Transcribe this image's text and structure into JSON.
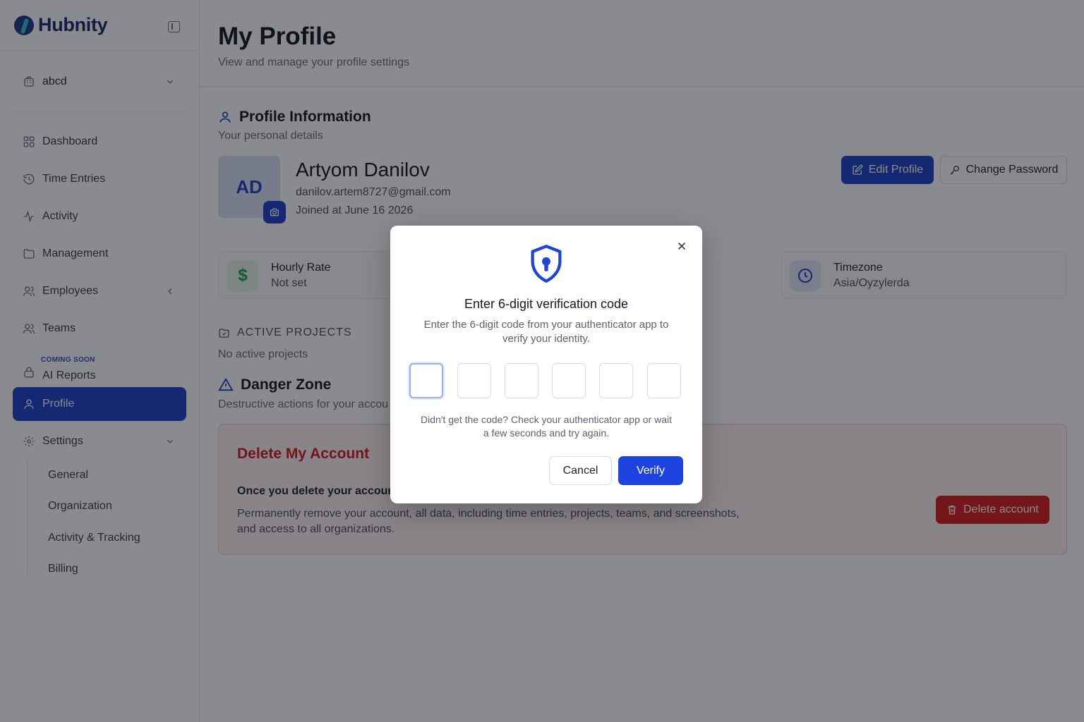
{
  "brand": {
    "name": "Hubnity"
  },
  "org": {
    "name": "abcd"
  },
  "nav": {
    "dashboard": "Dashboard",
    "time_entries": "Time Entries",
    "activity": "Activity",
    "management": "Management",
    "employees": "Employees",
    "teams": "Teams",
    "ai_reports": "AI Reports",
    "ai_reports_badge": "COMING SOON",
    "profile": "Profile",
    "settings": "Settings",
    "settings_sub": [
      "General",
      "Organization",
      "Activity & Tracking",
      "Billing"
    ]
  },
  "header": {
    "title": "My Profile",
    "subtitle": "View and manage your profile settings"
  },
  "profile_info": {
    "title": "Profile Information",
    "subtitle": "Your personal details",
    "initials": "AD",
    "name": "Artyom Danilov",
    "email": "danilov.artem8727@gmail.com",
    "joined": "Joined at June 16 2026",
    "edit_label": "Edit Profile",
    "change_password_label": "Change Password"
  },
  "stats": {
    "hourly_rate_label": "Hourly Rate",
    "hourly_rate_value": "Not set",
    "timezone_label": "Timezone",
    "timezone_value": "Asia/Oyzylerda"
  },
  "projects": {
    "title": "ACTIVE PROJECTS",
    "empty": "No active projects"
  },
  "danger": {
    "title": "Danger Zone",
    "subtitle": "Destructive actions for your accou",
    "box_title": "Delete My Account",
    "box_strong": "Once you delete your account",
    "box_text": "Permanently remove your account, all data, including time entries, projects, teams, and screenshots, and access to all organizations.",
    "delete_label": "Delete account"
  },
  "modal": {
    "title": "Enter 6-digit verification code",
    "description": "Enter the 6-digit code from your authenticator app to verify your identity.",
    "hint": "Didn't get the code? Check your authenticator app or wait a few seconds and try again.",
    "cancel_label": "Cancel",
    "verify_label": "Verify",
    "close_icon": "close-icon",
    "digits": [
      "",
      "",
      "",
      "",
      "",
      ""
    ]
  },
  "colors": {
    "accent": "#1d44c8",
    "danger": "#d71f1f",
    "brand": "#1b2d6b"
  }
}
